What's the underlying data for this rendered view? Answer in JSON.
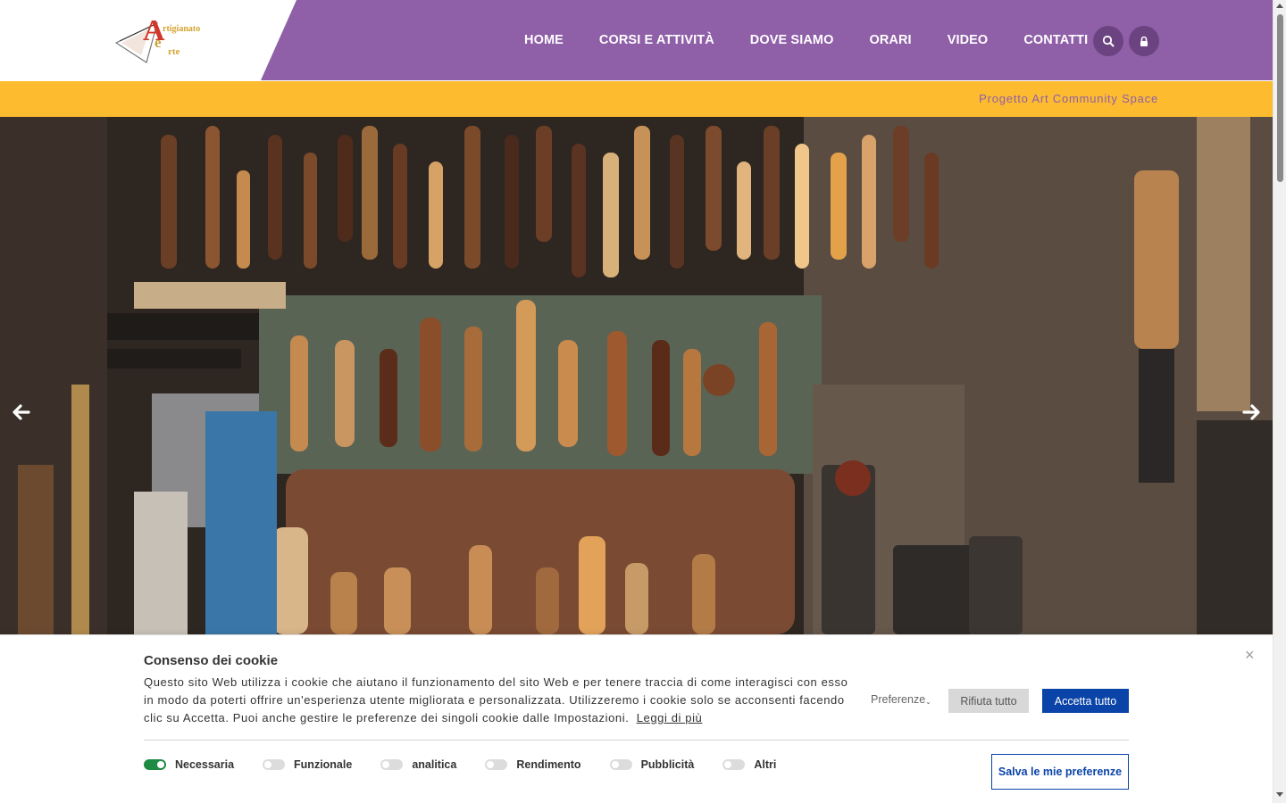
{
  "header": {
    "logo": {
      "text_main": "rtigianato",
      "text_e": "e",
      "text_arte": "rte",
      "letter_a": "A"
    },
    "nav": [
      "HOME",
      "CORSI E ATTIVITÀ",
      "DOVE SIAMO",
      "ORARI",
      "VIDEO",
      "CONTATTI"
    ],
    "icons": {
      "search": "search-icon",
      "login": "lock-icon"
    },
    "colors": {
      "brand": "#8f5fa8",
      "icon_bg": "#6b4380"
    }
  },
  "subbar": {
    "link": "Progetto Art Community Space",
    "color": "#fdbb30"
  },
  "hero": {
    "prev_icon": "arrow-left-icon",
    "next_icon": "arrow-right-icon"
  },
  "cookie": {
    "title": "Consenso dei cookie",
    "text": "Questo sito Web utilizza i cookie che aiutano il funzionamento del sito Web e per tenere traccia di come interagisci con esso in modo da poterti offrire un'esperienza utente migliorata e personalizzata. Utilizzeremo i cookie solo se acconsenti facendo clic su Accetta. Puoi anche gestire le preferenze dei singoli cookie dalle Impostazioni.",
    "read_more": "Leggi di più",
    "preferences": "Preferenze",
    "reject": "Rifiuta tutto",
    "accept": "Accetta tutto",
    "toggles": [
      {
        "label": "Necessaria",
        "on": true
      },
      {
        "label": "Funzionale",
        "on": false
      },
      {
        "label": "analitica",
        "on": false
      },
      {
        "label": "Rendimento",
        "on": false
      },
      {
        "label": "Pubblicità",
        "on": false
      },
      {
        "label": "Altri",
        "on": false
      }
    ],
    "save": "Salva le mie preferenze",
    "close_icon": "close-icon",
    "colors": {
      "accept": "#0b44a8",
      "toggle_on": "#1e8a43"
    }
  }
}
